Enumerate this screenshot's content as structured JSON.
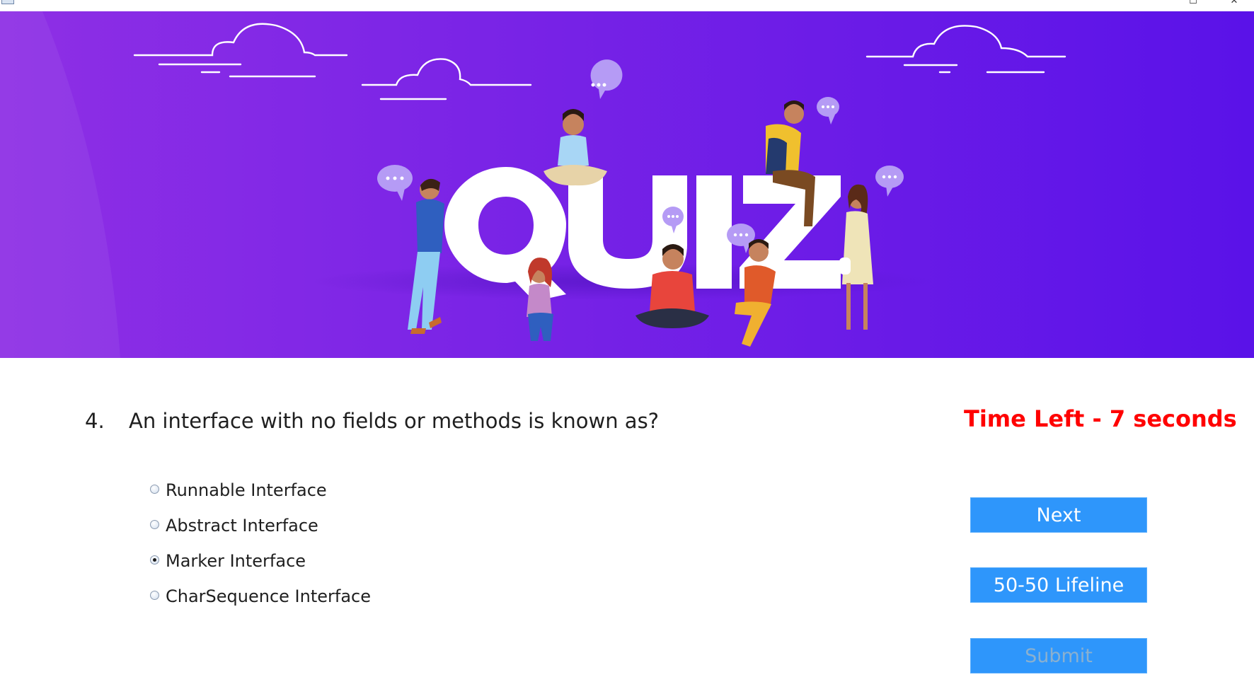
{
  "window": {
    "controls": [
      "maximize-icon",
      "close-icon"
    ]
  },
  "banner": {
    "word": "QUIZ",
    "colors": {
      "left": "#8e2fe5",
      "right": "#5a12e8"
    }
  },
  "question": {
    "number": "4.",
    "text": "An interface with no fields or methods is known as?"
  },
  "timer": {
    "label": "Time Left - 7 seconds",
    "color": "#ff0000"
  },
  "options": [
    {
      "label": "Runnable Interface",
      "selected": false
    },
    {
      "label": "Abstract Interface",
      "selected": false
    },
    {
      "label": "Marker Interface",
      "selected": true
    },
    {
      "label": "CharSequence Interface",
      "selected": false
    }
  ],
  "buttons": {
    "next": "Next",
    "lifeline": "50-50 Lifeline",
    "submit": "Submit",
    "color": "#2e96fb"
  }
}
